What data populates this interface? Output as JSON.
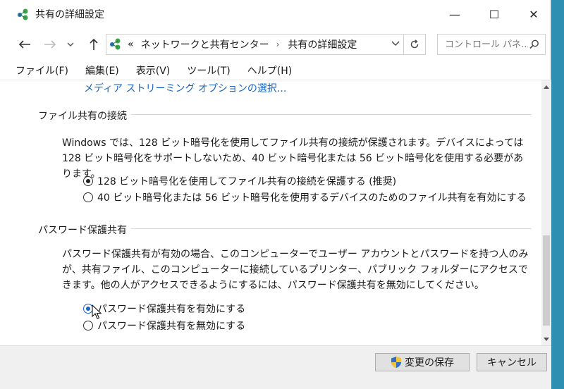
{
  "window": {
    "title": "共有の詳細設定",
    "controls": {
      "minimize": "—",
      "maximize": "☐",
      "close": "✕"
    }
  },
  "nav": {
    "back_icon": "arrow-left-icon",
    "forward_icon": "arrow-right-icon",
    "up_icon": "arrow-up-icon",
    "address": {
      "prefix": "«",
      "segments": [
        "ネットワークと共有センター",
        "共有の詳細設定"
      ],
      "separator": "›"
    },
    "search": {
      "placeholder": "コントロール パネ..."
    }
  },
  "menu": {
    "items": [
      "ファイル(F)",
      "編集(E)",
      "表示(V)",
      "ツール(T)",
      "ヘルプ(H)"
    ]
  },
  "content": {
    "top_link": "メディア ストリーミング オプションの選択...",
    "file_sharing": {
      "header": "ファイル共有の接続",
      "description": "Windows では、128 ビット暗号化を使用してファイル共有の接続が保護されます。デバイスによっては 128 ビット暗号化をサポートしないため、40 ビット暗号化または 56 ビット暗号化を使用する必要があります。",
      "options": [
        {
          "label": "128 ビット暗号化を使用してファイル共有の接続を保護する (推奨)",
          "checked": true
        },
        {
          "label": "40 ビット暗号化または 56 ビット暗号化を使用するデバイスのためのファイル共有を有効にする",
          "checked": false
        }
      ]
    },
    "password_sharing": {
      "header": "パスワード保護共有",
      "description": "パスワード保護共有が有効の場合、このコンピューターでユーザー アカウントとパスワードを持つ人のみが、共有ファイル、このコンピューターに接続しているプリンター、パブリック フォルダーにアクセスできます。他の人がアクセスできるようにするには、パスワード保護共有を無効にしてください。",
      "options": [
        {
          "label": "パスワード保護共有を有効にする",
          "checked": true
        },
        {
          "label": "パスワード保護共有を無効にする",
          "checked": false
        }
      ]
    }
  },
  "footer": {
    "save_label": "変更の保存",
    "cancel_label": "キャンセル"
  },
  "colors": {
    "desktop": "#2f8fb3",
    "link": "#1a64c0",
    "footer_bg": "#f0f0f0"
  }
}
